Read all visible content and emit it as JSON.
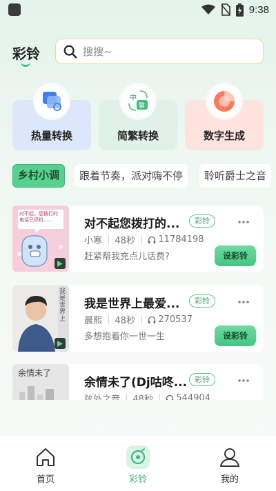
{
  "status_bar": {
    "time": "9:38",
    "icons": [
      "app-icon",
      "wifi-icon",
      "no-sim-icon",
      "battery-icon"
    ]
  },
  "header": {
    "title": "彩铃"
  },
  "search": {
    "placeholder": "搜搜~"
  },
  "features": [
    {
      "label": "热量转换",
      "icon": "convert-icon",
      "color": "#dfe9fb"
    },
    {
      "label": "简繁转换",
      "icon": "chinese-convert-icon",
      "icon_text_top": "中",
      "icon_text_bottom": "繁",
      "color": "#e0f2ea"
    },
    {
      "label": "数字生成",
      "icon": "number-generate-icon",
      "color": "#fde6e2"
    }
  ],
  "categories": [
    {
      "label": "乡村小调",
      "active": true
    },
    {
      "label": "跟着节奏，派对嗨不停",
      "active": false
    },
    {
      "label": "聆听爵士之音",
      "active": false
    }
  ],
  "songs": [
    {
      "title": "对不起您拨打的...",
      "tag": "彩铃",
      "artist": "小寒",
      "duration": "48秒",
      "plays": "11784198",
      "desc": "赶紧帮我充点儿话费?",
      "button": "设彩铃",
      "thumb_text": "对不起，您拨打的电话已停机……"
    },
    {
      "title": "我是世界上最爱...",
      "tag": "彩铃",
      "artist": "晨熙",
      "duration": "48秒",
      "plays": "270537",
      "desc": "多想抱着你一世一生",
      "button": "设彩铃",
      "thumb_text": "我是世界上"
    },
    {
      "title": "余情未了(Dj咕咚...",
      "tag": "彩铃",
      "artist": "弦外之音",
      "duration": "48秒",
      "plays": "544904",
      "desc": "",
      "button": "设彩铃",
      "thumb_text": "余情未了"
    }
  ],
  "nav": [
    {
      "label": "首页",
      "icon": "home-icon",
      "active": false
    },
    {
      "label": "彩铃",
      "icon": "ringtone-icon",
      "active": true
    },
    {
      "label": "我的",
      "icon": "profile-icon",
      "active": false
    }
  ],
  "colors": {
    "accent": "#3dbb7b",
    "button": "#58d08e"
  }
}
